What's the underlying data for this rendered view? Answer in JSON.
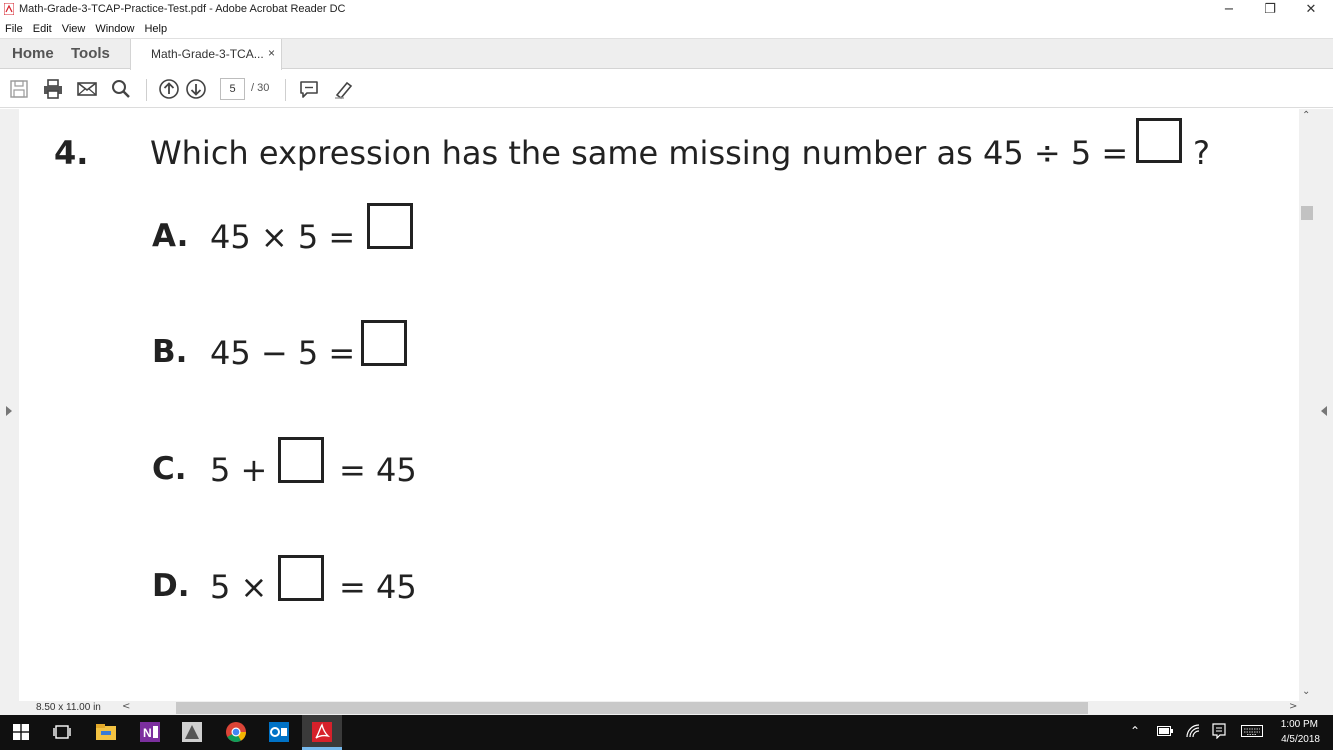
{
  "window": {
    "title": "Math-Grade-3-TCAP-Practice-Test.pdf - Adobe Acrobat Reader DC",
    "controls": {
      "minimize": "−",
      "restore": "❐",
      "close": "✕"
    }
  },
  "menu": [
    "File",
    "Edit",
    "View",
    "Window",
    "Help"
  ],
  "tabs": {
    "home": "Home",
    "tools": "Tools",
    "document": "Math-Grade-3-TCA...",
    "close": "×"
  },
  "toolbar": {
    "icons": [
      "save-icon",
      "print-icon",
      "email-icon",
      "search-icon",
      "page-up-icon",
      "page-down-icon",
      "comment-icon",
      "highlight-pen-icon"
    ],
    "page_current": "5",
    "page_total": "/ 30"
  },
  "question": {
    "number": "4.",
    "text": "Which expression has the same missing number as 45 ÷ 5 =",
    "end_mark": "?",
    "options": [
      {
        "letter": "A.",
        "before": "45 × 5 =",
        "after": ""
      },
      {
        "letter": "B.",
        "before": "45 − 5 =",
        "after": ""
      },
      {
        "letter": "C.",
        "before": "5 +",
        "after": "= 45"
      },
      {
        "letter": "D.",
        "before": "5 ×",
        "after": "= 45"
      }
    ]
  },
  "status": {
    "page_size": "8.50 x 11.00 in",
    "scroll_left": "<",
    "scroll_right": ">"
  },
  "taskbar": {
    "apps": [
      "windows-start-icon",
      "task-view-icon",
      "file-explorer-icon",
      "onenote-icon",
      "app-icon",
      "chrome-icon",
      "outlook-icon",
      "acrobat-icon"
    ],
    "time": "1:00 PM",
    "date": "4/5/2018"
  },
  "colors": {
    "acrobat_red": "#d6212b",
    "taskbar": "#101010",
    "tab_bg": "#eeeeee"
  }
}
